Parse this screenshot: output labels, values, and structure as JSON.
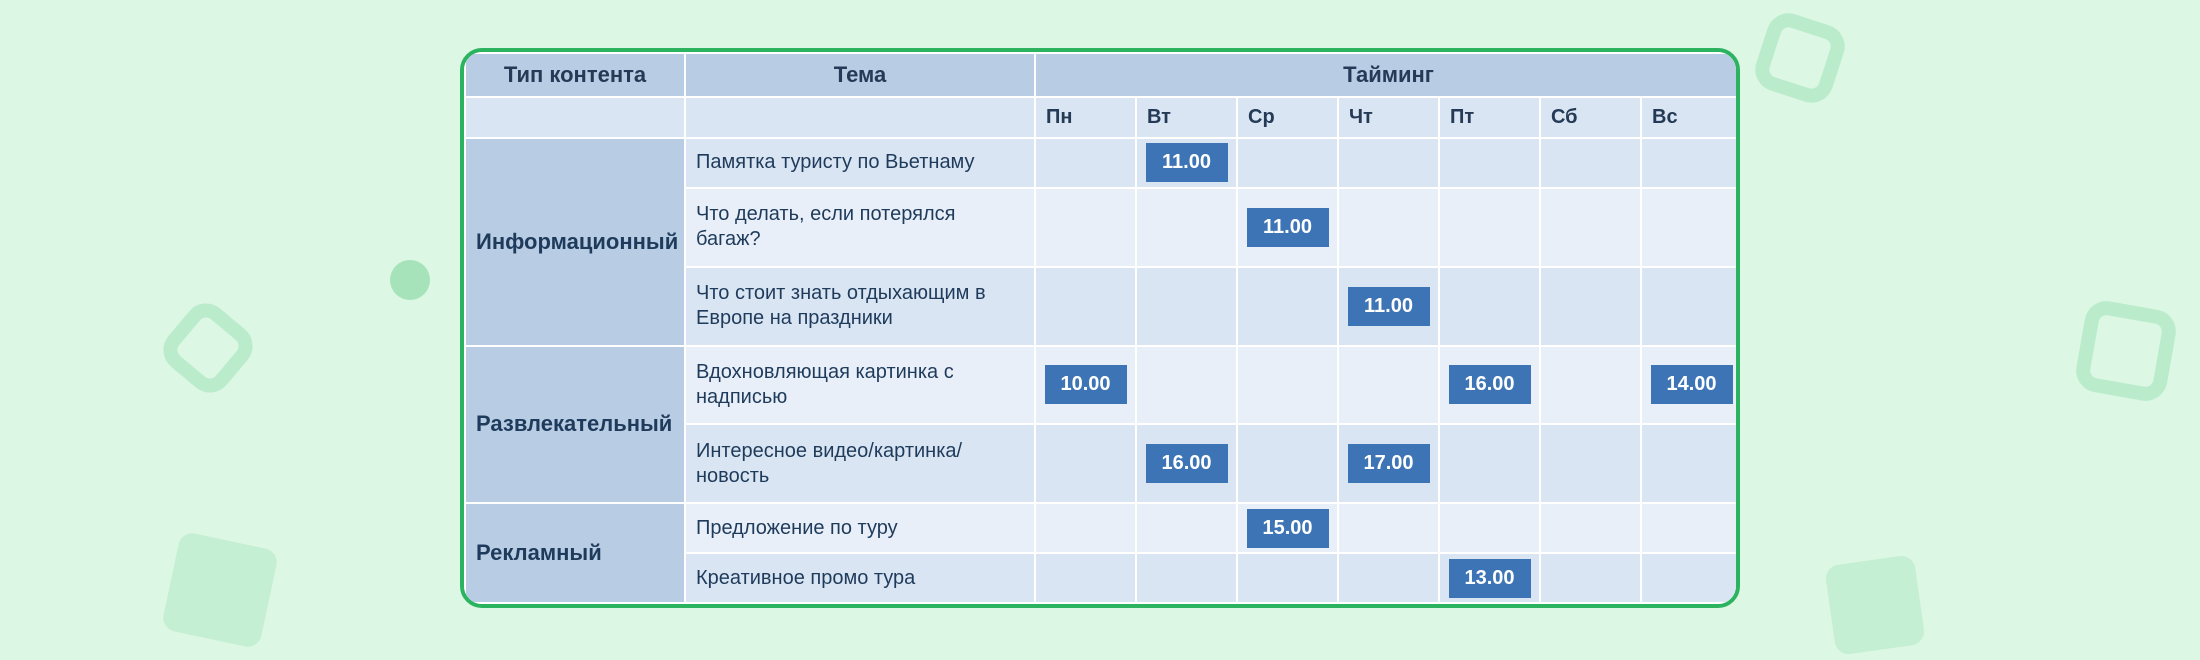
{
  "headers": {
    "type": "Тип контента",
    "topic": "Тема",
    "timing": "Тайминг"
  },
  "days": [
    "Пн",
    "Вт",
    "Ср",
    "Чт",
    "Пт",
    "Сб",
    "Вс"
  ],
  "groups": [
    {
      "name": "Информационный",
      "rows": [
        {
          "topic": "Памятка туристу по Вьетнаму",
          "slots": [
            "",
            "11.00",
            "",
            "",
            "",
            "",
            ""
          ]
        },
        {
          "topic": "Что делать, если потерялся багаж?",
          "slots": [
            "",
            "",
            "11.00",
            "",
            "",
            "",
            ""
          ]
        },
        {
          "topic": "Что стоит знать отдыхающим в Европе на праздники",
          "slots": [
            "",
            "",
            "",
            "11.00",
            "",
            "",
            ""
          ]
        }
      ]
    },
    {
      "name": "Развлекательный",
      "rows": [
        {
          "topic": "Вдохновляющая картинка с надписью",
          "slots": [
            "10.00",
            "",
            "",
            "",
            "16.00",
            "",
            "14.00"
          ]
        },
        {
          "topic": "Интересное видео/картинка/новость",
          "slots": [
            "",
            "16.00",
            "",
            "17.00",
            "",
            "",
            ""
          ]
        }
      ]
    },
    {
      "name": "Рекламный",
      "rows": [
        {
          "topic": "Предложение по туру",
          "slots": [
            "",
            "",
            "15.00",
            "",
            "",
            "",
            ""
          ]
        },
        {
          "topic": "Креативное промо тура",
          "slots": [
            "",
            "",
            "",
            "",
            "13.00",
            "",
            ""
          ]
        }
      ]
    }
  ],
  "chart_data": {
    "type": "table",
    "title": "Content plan timing",
    "columns": [
      "Тип контента",
      "Тема",
      "Пн",
      "Вт",
      "Ср",
      "Чт",
      "Пт",
      "Сб",
      "Вс"
    ],
    "rows": [
      [
        "Информационный",
        "Памятка туристу по Вьетнаму",
        "",
        "11.00",
        "",
        "",
        "",
        "",
        ""
      ],
      [
        "Информационный",
        "Что делать, если потерялся багаж?",
        "",
        "",
        "11.00",
        "",
        "",
        "",
        ""
      ],
      [
        "Информационный",
        "Что стоит знать отдыхающим в Европе на праздники",
        "",
        "",
        "",
        "11.00",
        "",
        "",
        ""
      ],
      [
        "Развлекательный",
        "Вдохновляющая картинка с надписью",
        "10.00",
        "",
        "",
        "",
        "16.00",
        "",
        "14.00"
      ],
      [
        "Развлекательный",
        "Интересное видео/картинка/новость",
        "",
        "16.00",
        "",
        "17.00",
        "",
        "",
        ""
      ],
      [
        "Рекламный",
        "Предложение по туру",
        "",
        "",
        "15.00",
        "",
        "",
        "",
        ""
      ],
      [
        "Рекламный",
        "Креативное промо тура",
        "",
        "",
        "",
        "",
        "13.00",
        "",
        ""
      ]
    ]
  }
}
